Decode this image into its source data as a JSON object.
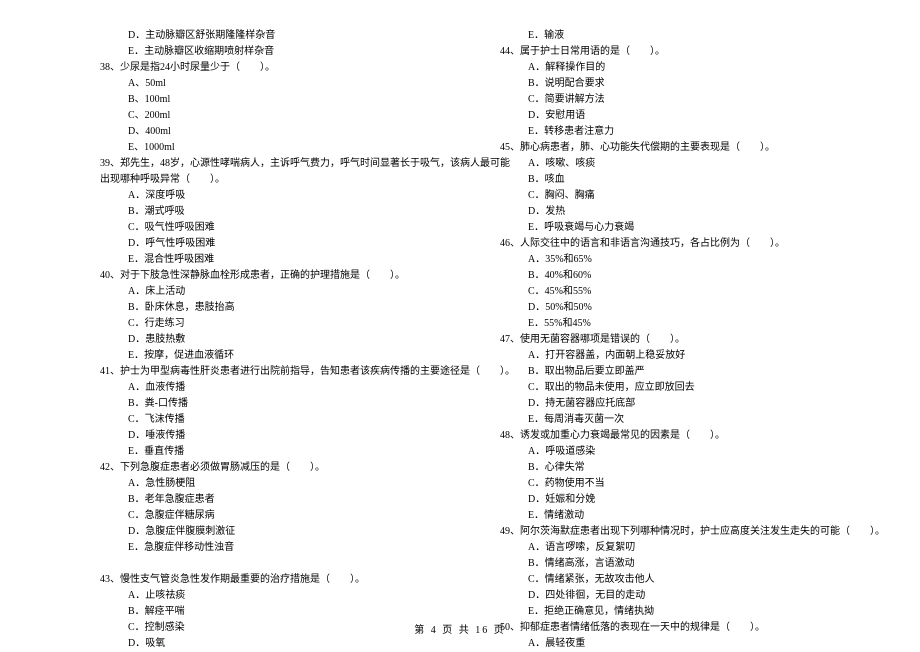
{
  "footer": "第 4 页 共 16 页",
  "left": [
    {
      "cls": "option",
      "t": "D．主动脉瓣区舒张期隆隆样杂音"
    },
    {
      "cls": "option",
      "t": "E．主动脉瓣区收缩期喷射样杂音"
    },
    {
      "cls": "q-indent",
      "t": "38、少尿是指24小时尿量少于（　　）。"
    },
    {
      "cls": "option",
      "t": "A、50ml"
    },
    {
      "cls": "option",
      "t": "B、100ml"
    },
    {
      "cls": "option",
      "t": "C、200ml"
    },
    {
      "cls": "option",
      "t": "D、400ml"
    },
    {
      "cls": "option",
      "t": "E、1000ml"
    },
    {
      "cls": "q-indent",
      "t": "39、郑先生，48岁，心源性哮喘病人，主诉呼气费力，呼气时间显著长于吸气，该病人最可能"
    },
    {
      "cls": "q-indent",
      "t": "出现哪种呼吸异常（　　）。"
    },
    {
      "cls": "option",
      "t": "A．深度呼吸"
    },
    {
      "cls": "option",
      "t": "B．潮式呼吸"
    },
    {
      "cls": "option",
      "t": "C．吸气性呼吸困难"
    },
    {
      "cls": "option",
      "t": "D．呼气性呼吸困难"
    },
    {
      "cls": "option",
      "t": "E．混合性呼吸困难"
    },
    {
      "cls": "q-indent",
      "t": "40、对于下肢急性深静脉血栓形成患者，正确的护理措施是（　　）。"
    },
    {
      "cls": "option",
      "t": "A．床上活动"
    },
    {
      "cls": "option",
      "t": "B．卧床休息，患肢抬高"
    },
    {
      "cls": "option",
      "t": "C．行走练习"
    },
    {
      "cls": "option",
      "t": "D．患肢热敷"
    },
    {
      "cls": "option",
      "t": "E．按摩，促进血液循环"
    },
    {
      "cls": "q-indent",
      "t": "41、护士为甲型病毒性肝炎患者进行出院前指导，告知患者该疾病传播的主要途径是（　　）。"
    },
    {
      "cls": "option",
      "t": "A．血液传播"
    },
    {
      "cls": "option",
      "t": "B．粪-口传播"
    },
    {
      "cls": "option",
      "t": "C．飞沫传播"
    },
    {
      "cls": "option",
      "t": "D．唾液传播"
    },
    {
      "cls": "option",
      "t": "E．垂直传播"
    },
    {
      "cls": "q-indent",
      "t": "42、下列急腹症患者必须做胃肠减压的是（　　）。"
    },
    {
      "cls": "option",
      "t": "A．急性肠梗阻"
    },
    {
      "cls": "option",
      "t": "B．老年急腹症患者"
    },
    {
      "cls": "option",
      "t": "C．急腹症伴糖尿病"
    },
    {
      "cls": "option",
      "t": "D．急腹症伴腹膜刺激征"
    },
    {
      "cls": "option",
      "t": "E．急腹症伴移动性浊音"
    },
    {
      "cls": "",
      "t": ""
    },
    {
      "cls": "q-indent",
      "t": "43、慢性支气管炎急性发作期最重要的治疗措施是（　　）。"
    },
    {
      "cls": "option",
      "t": "A．止咳祛痰"
    },
    {
      "cls": "option",
      "t": "B．解痉平喘"
    },
    {
      "cls": "option",
      "t": "C．控制感染"
    },
    {
      "cls": "option",
      "t": "D．吸氧"
    }
  ],
  "right": [
    {
      "cls": "option",
      "t": "E．输液"
    },
    {
      "cls": "q-indent",
      "t": "44、属于护士日常用语的是（　　）。"
    },
    {
      "cls": "option",
      "t": "A．解释操作目的"
    },
    {
      "cls": "option",
      "t": "B．说明配合要求"
    },
    {
      "cls": "option",
      "t": "C．简要讲解方法"
    },
    {
      "cls": "option",
      "t": "D．安慰用语"
    },
    {
      "cls": "option",
      "t": "E．转移患者注意力"
    },
    {
      "cls": "q-indent",
      "t": "45、肺心病患者，肺、心功能失代偿期的主要表现是（　　）。"
    },
    {
      "cls": "option",
      "t": "A．咳嗽、咳痰"
    },
    {
      "cls": "option",
      "t": "B．咳血"
    },
    {
      "cls": "option",
      "t": "C．胸闷、胸痛"
    },
    {
      "cls": "option",
      "t": "D．发热"
    },
    {
      "cls": "option",
      "t": "E．呼吸衰竭与心力衰竭"
    },
    {
      "cls": "q-indent",
      "t": "46、人际交往中的语言和非语言沟通技巧，各占比例为（　　）。"
    },
    {
      "cls": "option",
      "t": "A．35%和65%"
    },
    {
      "cls": "option",
      "t": "B．40%和60%"
    },
    {
      "cls": "option",
      "t": "C．45%和55%"
    },
    {
      "cls": "option",
      "t": "D．50%和50%"
    },
    {
      "cls": "option",
      "t": "E．55%和45%"
    },
    {
      "cls": "q-indent",
      "t": "47、使用无菌容器哪项是错误的（　　）。"
    },
    {
      "cls": "option",
      "t": "A．打开容器盖，内面朝上稳妥放好"
    },
    {
      "cls": "option",
      "t": "B．取出物品后要立即盖严"
    },
    {
      "cls": "option",
      "t": "C．取出的物品未使用，应立即放回去"
    },
    {
      "cls": "option",
      "t": "D．持无菌容器应托底部"
    },
    {
      "cls": "option",
      "t": "E．每周消毒灭菌一次"
    },
    {
      "cls": "q-indent",
      "t": "48、诱发或加重心力衰竭最常见的因素是（　　）。"
    },
    {
      "cls": "option",
      "t": "A．呼吸道感染"
    },
    {
      "cls": "option",
      "t": "B．心律失常"
    },
    {
      "cls": "option",
      "t": "C．药物使用不当"
    },
    {
      "cls": "option",
      "t": "D．妊娠和分娩"
    },
    {
      "cls": "option",
      "t": "E．情绪激动"
    },
    {
      "cls": "q-indent",
      "t": "49、阿尔茨海默症患者出现下列哪种情况时，护士应高度关注发生走失的可能（　　）。"
    },
    {
      "cls": "option",
      "t": "A．语言啰嗦，反复絮叨"
    },
    {
      "cls": "option",
      "t": "B．情绪高涨，言语激动"
    },
    {
      "cls": "option",
      "t": "C．情绪紧张，无故攻击他人"
    },
    {
      "cls": "option",
      "t": "D．四处徘徊，无目的走动"
    },
    {
      "cls": "option",
      "t": "E．拒绝正确意见，情绪执拗"
    },
    {
      "cls": "q-indent",
      "t": "50、抑郁症患者情绪低落的表现在一天中的规律是（　　）。"
    },
    {
      "cls": "option",
      "t": "A．晨轻夜重"
    }
  ]
}
